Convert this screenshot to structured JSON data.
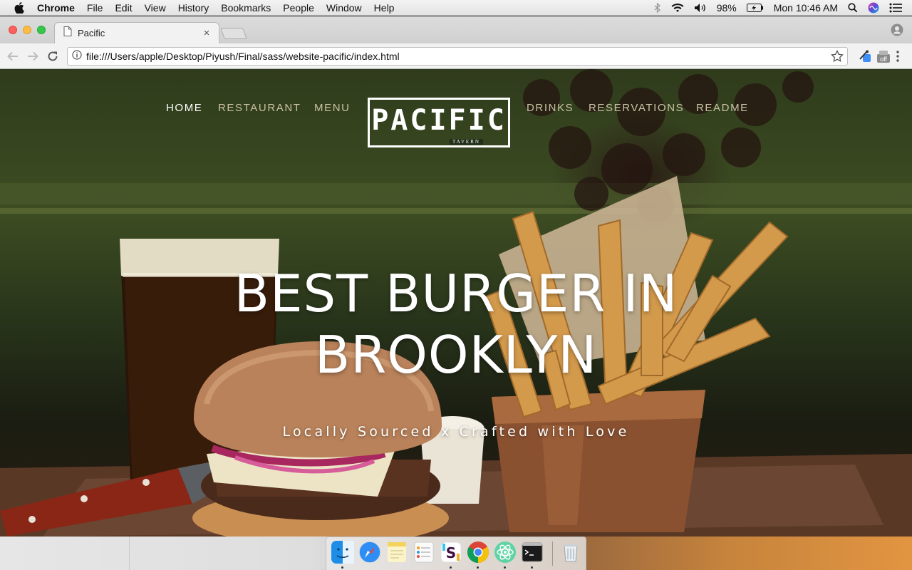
{
  "menubar": {
    "app_name": "Chrome",
    "items": [
      "File",
      "Edit",
      "View",
      "History",
      "Bookmarks",
      "People",
      "Window",
      "Help"
    ],
    "battery": "98%",
    "clock": "Mon 10:46 AM"
  },
  "browser": {
    "tab_title": "Pacific",
    "tab_close": "×",
    "url": "file:///Users/apple/Desktop/Piyush/Final/sass/website-pacific/index.html",
    "extension_badge": "off"
  },
  "site": {
    "nav_left": [
      "HOME",
      "RESTAURANT",
      "MENU"
    ],
    "nav_right": [
      "DRINKS",
      "RESERVATIONS",
      "README"
    ],
    "active_nav": "HOME",
    "logo_main": "PACIFIC",
    "logo_sub": "TAVERN",
    "hero_title": "BEST BURGER IN BROOKLYN",
    "hero_subtitle": "Locally Sourced x Crafted with Love"
  },
  "dock": {
    "apps": [
      "finder-icon",
      "safari-icon",
      "notes-icon",
      "reminders-icon",
      "slack-icon",
      "chrome-icon",
      "atom-icon",
      "terminal-icon",
      "trash-icon"
    ]
  }
}
